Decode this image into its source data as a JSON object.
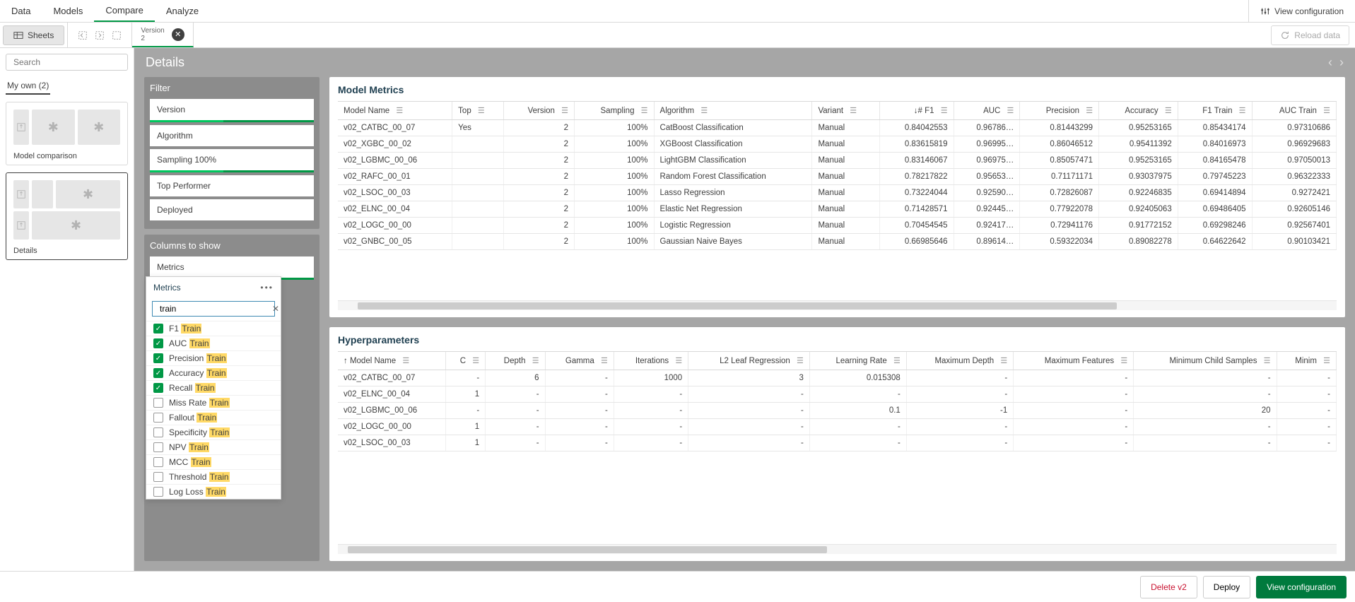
{
  "topnav": {
    "tabs": [
      "Data",
      "Models",
      "Compare",
      "Analyze"
    ],
    "active": 2,
    "view_config": "View configuration"
  },
  "toolbar": {
    "sheets": "Sheets",
    "version_label": "Version",
    "version_num": "2",
    "reload": "Reload data"
  },
  "sidebar": {
    "search_placeholder": "Search",
    "my_own": "My own (2)",
    "thumb1_label": "Model comparison",
    "thumb2_label": "Details"
  },
  "details": {
    "title": "Details"
  },
  "filter": {
    "title": "Filter",
    "items": [
      {
        "label": "Version",
        "active": true
      },
      {
        "label": "Algorithm",
        "active": false
      },
      {
        "label": "Sampling 100%",
        "active": true
      },
      {
        "label": "Top Performer",
        "active": false
      },
      {
        "label": "Deployed",
        "active": false
      }
    ]
  },
  "columns": {
    "title": "Columns to show",
    "items": [
      {
        "label": "Metrics",
        "active": true
      }
    ]
  },
  "metrics_popup": {
    "title": "Metrics",
    "search_value": "train",
    "options": [
      {
        "prefix": "F1 ",
        "hl": "Train",
        "checked": true
      },
      {
        "prefix": "AUC ",
        "hl": "Train",
        "checked": true
      },
      {
        "prefix": "Precision ",
        "hl": "Train",
        "checked": true
      },
      {
        "prefix": "Accuracy ",
        "hl": "Train",
        "checked": true
      },
      {
        "prefix": "Recall ",
        "hl": "Train",
        "checked": true
      },
      {
        "prefix": "Miss Rate ",
        "hl": "Train",
        "checked": false
      },
      {
        "prefix": "Fallout ",
        "hl": "Train",
        "checked": false
      },
      {
        "prefix": "Specificity ",
        "hl": "Train",
        "checked": false
      },
      {
        "prefix": "NPV ",
        "hl": "Train",
        "checked": false
      },
      {
        "prefix": "MCC ",
        "hl": "Train",
        "checked": false
      },
      {
        "prefix": "Threshold ",
        "hl": "Train",
        "checked": false
      },
      {
        "prefix": "Log Loss ",
        "hl": "Train",
        "checked": false
      }
    ]
  },
  "metrics_table": {
    "title": "Model Metrics",
    "columns": [
      "Model Name",
      "Top",
      "Version",
      "Sampling",
      "Algorithm",
      "Variant",
      "F1",
      "AUC",
      "Precision",
      "Accuracy",
      "F1 Train",
      "AUC Train"
    ],
    "num_cols": [
      false,
      false,
      true,
      true,
      false,
      false,
      true,
      true,
      true,
      true,
      true,
      true
    ],
    "sort_col": 6,
    "rows": [
      [
        "v02_CATBC_00_07",
        "Yes",
        "2",
        "100%",
        "CatBoost Classification",
        "Manual",
        "0.84042553",
        "0.96786…",
        "0.81443299",
        "0.95253165",
        "0.85434174",
        "0.97310686"
      ],
      [
        "v02_XGBC_00_02",
        "",
        "2",
        "100%",
        "XGBoost Classification",
        "Manual",
        "0.83615819",
        "0.96995…",
        "0.86046512",
        "0.95411392",
        "0.84016973",
        "0.96929683"
      ],
      [
        "v02_LGBMC_00_06",
        "",
        "2",
        "100%",
        "LightGBM Classification",
        "Manual",
        "0.83146067",
        "0.96975…",
        "0.85057471",
        "0.95253165",
        "0.84165478",
        "0.97050013"
      ],
      [
        "v02_RAFC_00_01",
        "",
        "2",
        "100%",
        "Random Forest Classification",
        "Manual",
        "0.78217822",
        "0.95653…",
        "0.71171171",
        "0.93037975",
        "0.79745223",
        "0.96322333"
      ],
      [
        "v02_LSOC_00_03",
        "",
        "2",
        "100%",
        "Lasso Regression",
        "Manual",
        "0.73224044",
        "0.92590…",
        "0.72826087",
        "0.92246835",
        "0.69414894",
        "0.9272421"
      ],
      [
        "v02_ELNC_00_04",
        "",
        "2",
        "100%",
        "Elastic Net Regression",
        "Manual",
        "0.71428571",
        "0.92445…",
        "0.77922078",
        "0.92405063",
        "0.69486405",
        "0.92605146"
      ],
      [
        "v02_LOGC_00_00",
        "",
        "2",
        "100%",
        "Logistic Regression",
        "Manual",
        "0.70454545",
        "0.92417…",
        "0.72941176",
        "0.91772152",
        "0.69298246",
        "0.92567401"
      ],
      [
        "v02_GNBC_00_05",
        "",
        "2",
        "100%",
        "Gaussian Naive Bayes",
        "Manual",
        "0.66985646",
        "0.89614…",
        "0.59322034",
        "0.89082278",
        "0.64622642",
        "0.90103421"
      ]
    ]
  },
  "hyper_table": {
    "title": "Hyperparameters",
    "columns": [
      "Model Name",
      "C",
      "Depth",
      "Gamma",
      "Iterations",
      "L2 Leaf Regression",
      "Learning Rate",
      "Maximum Depth",
      "Maximum Features",
      "Minimum Child Samples",
      "Minim"
    ],
    "num_cols": [
      false,
      true,
      true,
      true,
      true,
      true,
      true,
      true,
      true,
      true,
      true
    ],
    "sort_col": 0,
    "rows": [
      [
        "v02_CATBC_00_07",
        "-",
        "6",
        "-",
        "1000",
        "3",
        "0.015308",
        "-",
        "-",
        "-",
        "-"
      ],
      [
        "v02_ELNC_00_04",
        "1",
        "-",
        "-",
        "-",
        "-",
        "-",
        "-",
        "-",
        "-",
        "-"
      ],
      [
        "v02_LGBMC_00_06",
        "-",
        "-",
        "-",
        "-",
        "-",
        "0.1",
        "-1",
        "-",
        "20",
        "-"
      ],
      [
        "v02_LOGC_00_00",
        "1",
        "-",
        "-",
        "-",
        "-",
        "-",
        "-",
        "-",
        "-",
        "-"
      ],
      [
        "v02_LSOC_00_03",
        "1",
        "-",
        "-",
        "-",
        "-",
        "-",
        "-",
        "-",
        "-",
        "-"
      ]
    ]
  },
  "footer": {
    "delete": "Delete v2",
    "deploy": "Deploy",
    "view_config": "View configuration"
  }
}
